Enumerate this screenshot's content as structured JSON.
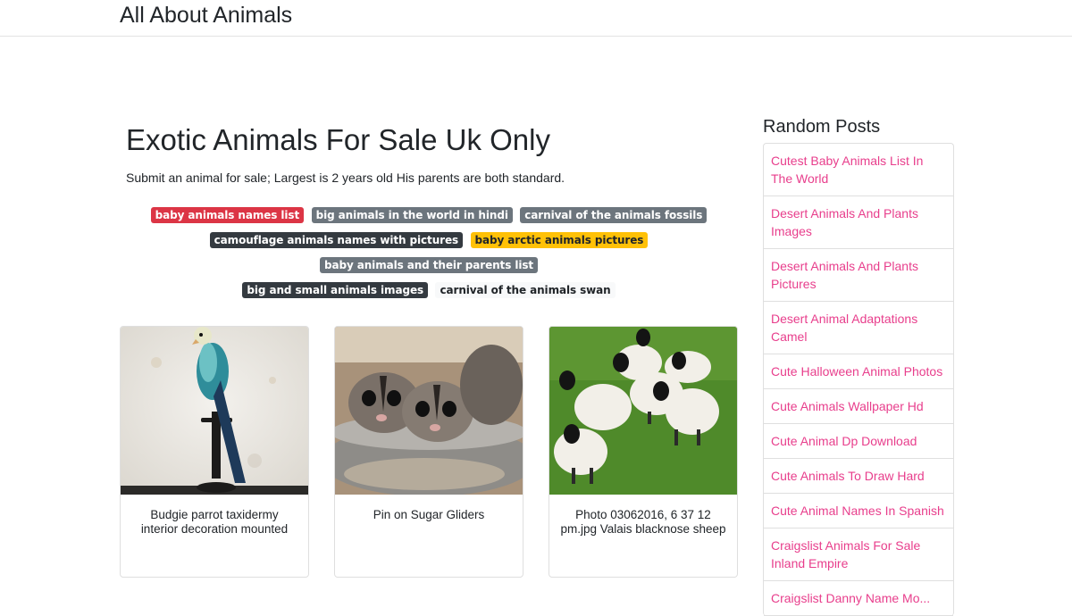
{
  "header": {
    "site_title": "All About Animals"
  },
  "main": {
    "title": "Exotic Animals For Sale Uk Only",
    "description": "Submit an animal for sale; Largest is 2 years old His parents are both standard.",
    "tags": [
      {
        "label": "baby animals names list",
        "style": "danger"
      },
      {
        "label": "big animals in the world in hindi",
        "style": "secondary"
      },
      {
        "label": "carnival of the animals fossils",
        "style": "secondary"
      },
      {
        "label": "camouflage animals names with pictures",
        "style": "dark"
      },
      {
        "label": "baby arctic animals pictures",
        "style": "warning"
      },
      {
        "label": "baby animals and their parents list",
        "style": "secondary"
      },
      {
        "label": "big and small animals images",
        "style": "dark"
      },
      {
        "label": "carnival of the animals swan",
        "style": "light"
      }
    ],
    "cards": [
      {
        "caption": "Budgie parrot taxidermy interior decoration mounted"
      },
      {
        "caption": "Pin on Sugar Gliders"
      },
      {
        "caption": "Photo 03062016, 6 37 12 pm.jpg Valais blacknose sheep"
      }
    ]
  },
  "sidebar": {
    "title": "Random Posts",
    "posts": [
      "Cutest Baby Animals List In The World",
      "Desert Animals And Plants Images",
      "Desert Animals And Plants Pictures",
      "Desert Animal Adaptations Camel",
      "Cute Halloween Animal Photos",
      "Cute Animals Wallpaper Hd",
      "Cute Animal Dp Download",
      "Cute Animals To Draw Hard",
      "Cute Animal Names In Spanish",
      "Craigslist Animals For Sale Inland Empire",
      "Craigslist Danny Name Mo..."
    ]
  },
  "colors": {
    "link_pink": "#e83e8c",
    "badge_danger": "#dc3545",
    "badge_secondary": "#6c757d",
    "badge_dark": "#343a40",
    "badge_warning": "#ffc107",
    "badge_light": "#f8f9fa"
  }
}
